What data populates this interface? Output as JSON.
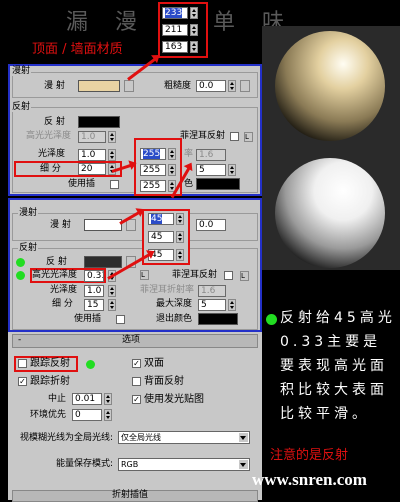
{
  "watermark": {
    "top": "漏 漫 空 单 味",
    "bottom": "www.snren.com"
  },
  "annotations": {
    "top_label": "顶面 / 墙面材质",
    "side_note": "反射给45高光0.33主要是要表现高光面积比较大表面比较平滑。",
    "warning": "注意的是反射"
  },
  "color_popup_top": {
    "r": "233",
    "g": "211",
    "b": "163"
  },
  "color_popup_reflect": {
    "r": "255",
    "g": "255",
    "b": "255"
  },
  "color_popup_diffuse2": {
    "r": "45",
    "g": "45",
    "b": "45"
  },
  "material1": {
    "diffuse_group": "漫射",
    "diffuse_label": "漫 射",
    "roughness_label": "粗糙度",
    "roughness": "0.0",
    "reflect_group": "反射",
    "reflect_label": "反 射",
    "hilight_label": "高光光泽度",
    "hilight_value": "1.0",
    "fresnel_label": "菲涅耳反射",
    "L": "L",
    "gloss_label": "光泽度",
    "gloss_value": "1.0",
    "fresnel_ior_value": "1.6",
    "fresnel_ior_suffix": "率",
    "subdiv_label": "细 分",
    "subdiv_value": "20",
    "depth_value": "5",
    "use_interp_label": "使用插",
    "color_suffix": "色"
  },
  "material2": {
    "diffuse_group": "漫射",
    "diffuse_label": "漫 射",
    "roughness": "0.0",
    "reflect_group": "反射",
    "reflect_label": "反 射",
    "hilight_label": "高光光泽度",
    "hilight_value": "0.33",
    "fresnel_label": "菲涅耳反射",
    "fresnel_ior_label": "菲涅耳折射率",
    "fresnel_ior_value": "1.6",
    "L": "L",
    "gloss_label": "光泽度",
    "gloss_value": "1.0",
    "max_depth_label": "最大深度",
    "max_depth_value": "5",
    "subdiv_label": "细 分",
    "subdiv_value": "15",
    "exit_color_label": "退出颜色",
    "use_interp_label": "使用插"
  },
  "options": {
    "header": "选项",
    "minus": "-",
    "trace_reflect": "跟踪反射",
    "trace_refract": "跟踪折射",
    "double_sided": "双面",
    "back_reflect": "背面反射",
    "use_glow": "使用发光贴图",
    "cutoff_label": "中止",
    "cutoff_value": "0.01",
    "env_priority_label": "环境优先",
    "env_priority_value": "0",
    "gi_label": "视模糊光线为全局光线:",
    "gi_value": "仅全局光线",
    "energy_label": "能量保存模式:",
    "energy_value": "RGB",
    "footer": "折射插值"
  },
  "colors": {
    "accent_blue": "#2330c8",
    "accent_red": "#e01010",
    "green_dot": "#22dd22",
    "diffuse_swatch": "#e9d3a3",
    "panel": "#c8c8c8"
  }
}
